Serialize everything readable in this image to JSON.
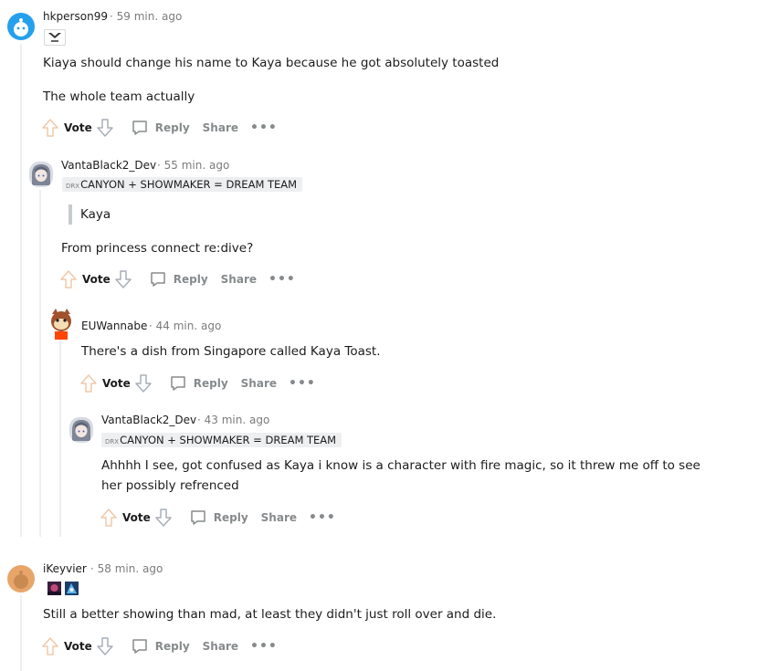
{
  "comments": [
    {
      "username": "hkperson99",
      "time": "· 59 min. ago",
      "flair_icon": "lgd-team-logo-icon",
      "body": [
        "Kiaya should change his name to Kaya because he got absolutely toasted",
        "The whole team actually"
      ],
      "actions": {
        "vote": "Vote",
        "reply": "Reply",
        "share": "Share",
        "more": "•••"
      }
    },
    {
      "username": "VantaBlack2_Dev",
      "time": "· 55 min. ago",
      "flair_small": "DRX",
      "flair": "CANYON + SHOWMAKER = DREAM TEAM",
      "quote": "Kaya",
      "body": [
        "From princess connect re:dive?"
      ],
      "actions": {
        "vote": "Vote",
        "reply": "Reply",
        "share": "Share",
        "more": "•••"
      }
    },
    {
      "username": "EUWannabe",
      "time": "· 44 min. ago",
      "body": [
        "There's a dish from Singapore called Kaya Toast."
      ],
      "actions": {
        "vote": "Vote",
        "reply": "Reply",
        "share": "Share",
        "more": "•••"
      }
    },
    {
      "username": "VantaBlack2_Dev",
      "time": "· 43 min. ago",
      "flair_small": "DRX",
      "flair": "CANYON + SHOWMAKER = DREAM TEAM",
      "body": [
        "Ahhhh I see, got confused as Kaya i know is a character with fire magic, so it threw me off to see",
        "her possibly refrenced"
      ],
      "actions": {
        "vote": "Vote",
        "reply": "Reply",
        "share": "Share",
        "more": "•••"
      }
    },
    {
      "username": "iKeyvier",
      "time": "· 58 min. ago",
      "flair_icons": [
        "champion-portrait-icon",
        "champion-portrait-icon"
      ],
      "body": [
        "Still a better showing than mad, at least they didn't just roll over and die."
      ],
      "actions": {
        "vote": "Vote",
        "reply": "Reply",
        "share": "Share",
        "more": "•••"
      }
    }
  ],
  "colors": {
    "thread_line": "#edeff1",
    "meta_text": "#7c7c7c",
    "action_text": "#878a8c",
    "avatar_blue": "#24a0ed",
    "avatar_orange": "#e8a56a"
  }
}
